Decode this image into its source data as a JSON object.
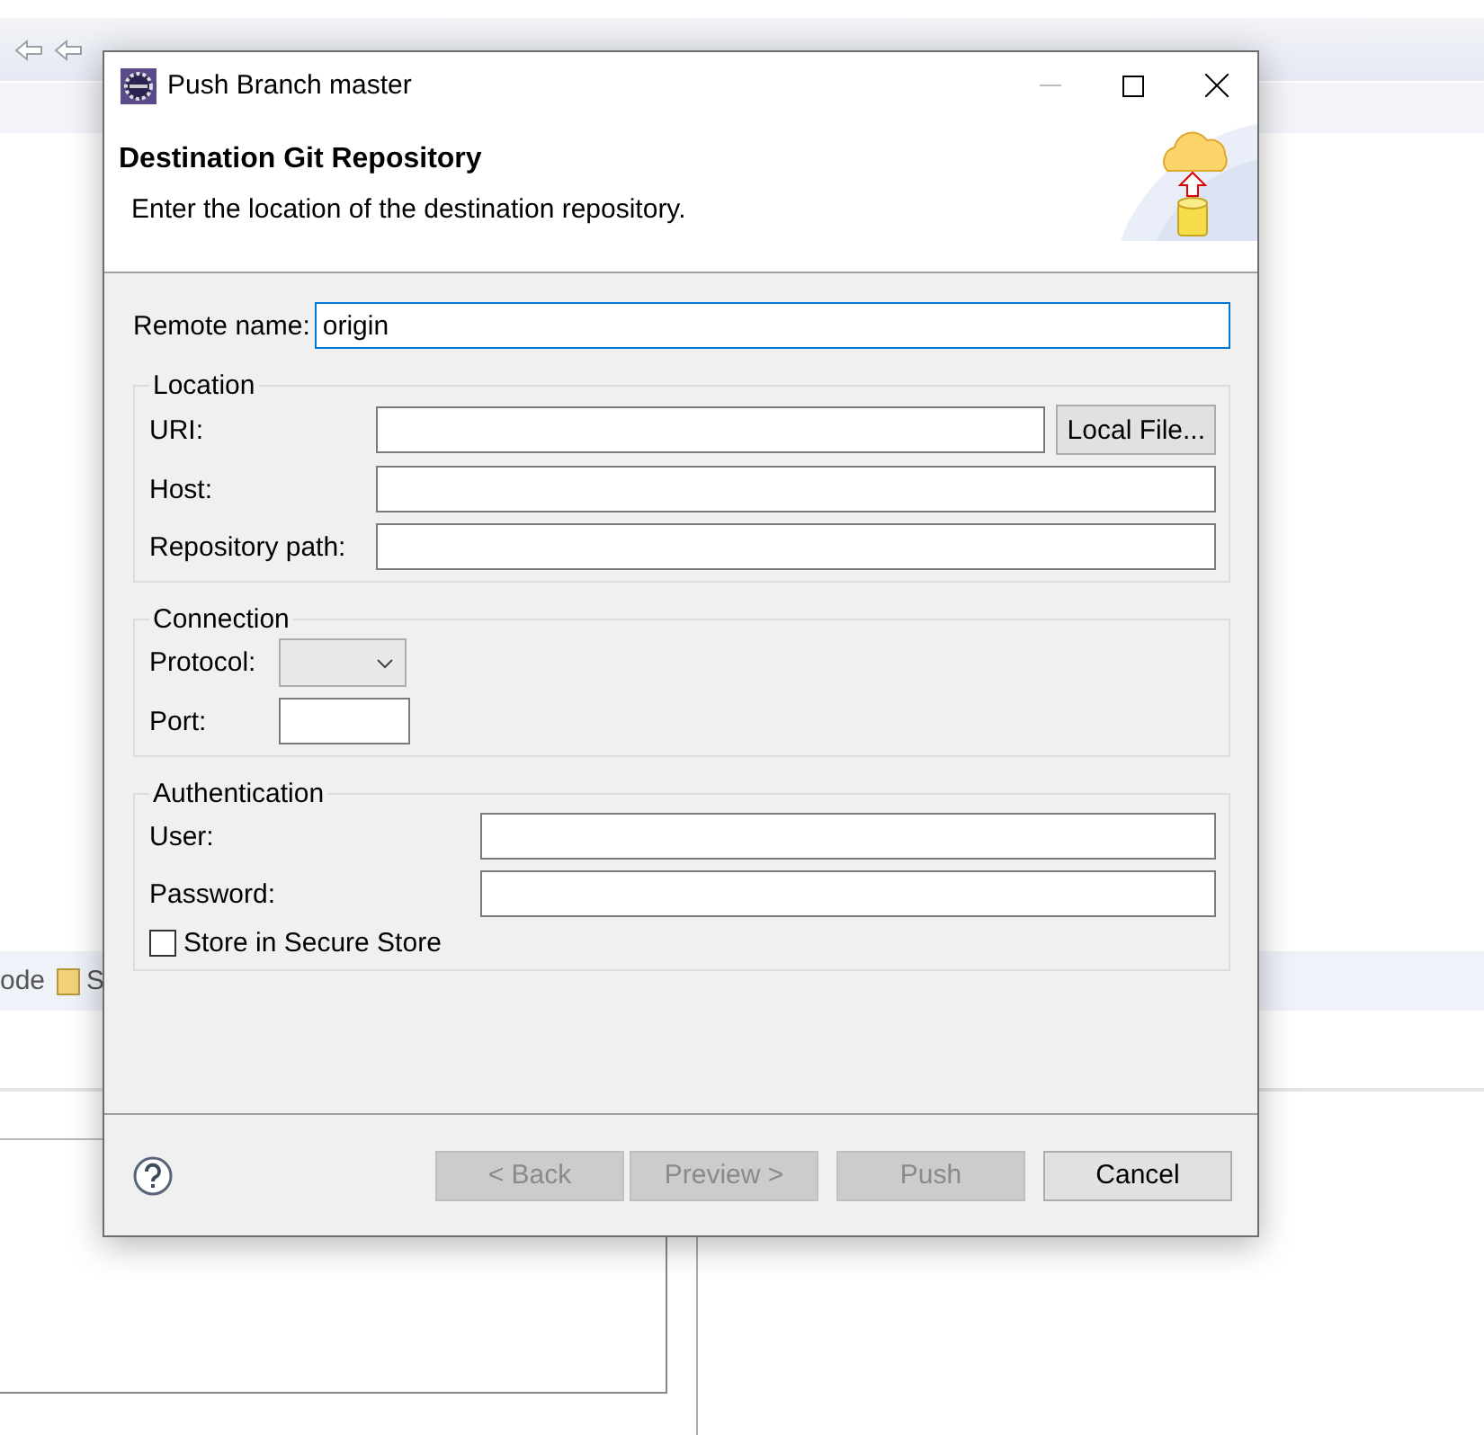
{
  "background": {
    "tabs": [
      {
        "label": "ode"
      },
      {
        "label": "S"
      }
    ]
  },
  "dialog": {
    "title": "Push Branch master",
    "header": {
      "title": "Destination Git Repository",
      "description": "Enter the location of the destination repository."
    },
    "remote_name": {
      "label": "Remote name:",
      "value": "origin",
      "focused": true
    },
    "groups": [
      {
        "title": "Location",
        "fields": [
          {
            "kind": "text",
            "label": "URI:",
            "button": "Local File..."
          },
          {
            "kind": "text",
            "label": "Host:"
          },
          {
            "kind": "text",
            "label": "Repository path:"
          }
        ]
      },
      {
        "title": "Connection",
        "fields": [
          {
            "kind": "combo",
            "label": "Protocol:",
            "disabled": true
          },
          {
            "kind": "short",
            "label": "Port:"
          }
        ]
      },
      {
        "title": "Authentication",
        "fields": [
          {
            "kind": "text",
            "label": "User:"
          },
          {
            "kind": "text",
            "label": "Password:"
          },
          {
            "kind": "checkbox",
            "label": "Store in Secure Store",
            "checked": false
          }
        ]
      }
    ],
    "buttons": [
      {
        "label": "< Back",
        "disabled": true
      },
      {
        "label": "Preview >",
        "disabled": true
      },
      {
        "label": "Push",
        "disabled": true
      },
      {
        "label": "Cancel",
        "disabled": false
      }
    ]
  }
}
